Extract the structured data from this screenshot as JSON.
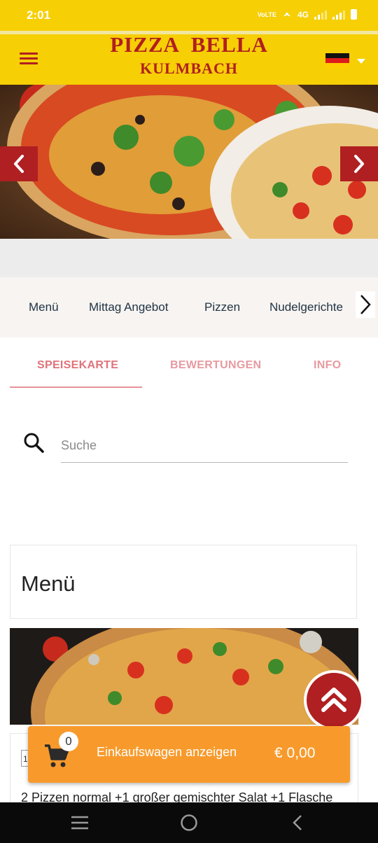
{
  "status_bar": {
    "time": "2:01",
    "network": "4G",
    "volte": "VoLTE"
  },
  "header": {
    "brand_line1": "PIZZA  BELLA",
    "brand_line2": "KULMBACH",
    "menu_icon": "hamburger-icon",
    "language_flag": "german-flag",
    "accent_color": "#b01f21",
    "header_color": "#f6cf05"
  },
  "categories": [
    "Menü",
    "Mittag Angebot",
    "Pizzen",
    "Nudelgerichte"
  ],
  "tabs": [
    {
      "label": "SPEISEKARTE",
      "active": true
    },
    {
      "label": "BEWERTUNGEN",
      "active": false
    },
    {
      "label": "INFO",
      "active": false
    }
  ],
  "search": {
    "placeholder": "Suche",
    "value": ""
  },
  "menu_section": {
    "title": "Menü",
    "first_item_qty": "1",
    "first_item_text": "2 Pizzen normal +1 großer gemischter Salat +1 Flasche"
  },
  "cart": {
    "count": "0",
    "label": "Einkaufswagen anzeigen",
    "total": "€ 0,00",
    "color": "#f89a2b"
  }
}
